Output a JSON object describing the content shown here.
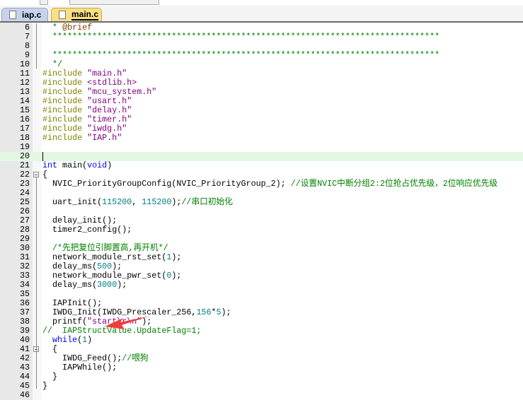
{
  "tabs": [
    {
      "label": "iap.c",
      "active": false
    },
    {
      "label": "main.c",
      "active": true
    }
  ],
  "current_line": 20,
  "lines": [
    {
      "n": "6",
      "seg": [
        [
          "pl",
          "  "
        ],
        [
          "cm",
          "* "
        ],
        [
          "tg",
          "@brief"
        ]
      ]
    },
    {
      "n": "7",
      "seg": [
        [
          "cm",
          "  ******************************************************************************"
        ]
      ]
    },
    {
      "n": "8",
      "seg": []
    },
    {
      "n": "9",
      "seg": [
        [
          "cm",
          "  ******************************************************************************"
        ]
      ]
    },
    {
      "n": "10",
      "seg": [
        [
          "cm",
          "  */"
        ]
      ]
    },
    {
      "n": "11",
      "seg": [
        [
          "pp",
          "#include "
        ],
        [
          "st",
          "\"main.h\""
        ]
      ]
    },
    {
      "n": "12",
      "seg": [
        [
          "pp",
          "#include "
        ],
        [
          "st",
          "<stdlib.h>"
        ]
      ]
    },
    {
      "n": "13",
      "seg": [
        [
          "pp",
          "#include "
        ],
        [
          "st",
          "\"mcu_system.h\""
        ]
      ]
    },
    {
      "n": "14",
      "seg": [
        [
          "pp",
          "#include "
        ],
        [
          "st",
          "\"usart.h\""
        ]
      ]
    },
    {
      "n": "15",
      "seg": [
        [
          "pp",
          "#include "
        ],
        [
          "st",
          "\"delay.h\""
        ]
      ]
    },
    {
      "n": "16",
      "seg": [
        [
          "pp",
          "#include "
        ],
        [
          "st",
          "\"timer.h\""
        ]
      ]
    },
    {
      "n": "17",
      "seg": [
        [
          "pp",
          "#include "
        ],
        [
          "st",
          "\"iwdg.h\""
        ]
      ]
    },
    {
      "n": "18",
      "seg": [
        [
          "pp",
          "#include "
        ],
        [
          "st",
          "\"IAP.h\""
        ]
      ]
    },
    {
      "n": "19",
      "seg": []
    },
    {
      "n": "20",
      "seg": []
    },
    {
      "n": "21",
      "seg": [
        [
          "kw",
          "int"
        ],
        [
          "pl",
          " main("
        ],
        [
          "kw",
          "void"
        ],
        [
          "pl",
          ")"
        ]
      ]
    },
    {
      "n": "22",
      "seg": [
        [
          "pl",
          "{"
        ]
      ]
    },
    {
      "n": "23",
      "seg": [
        [
          "pl",
          "  NVIC_PriorityGroupConfig(NVIC_PriorityGroup_2); "
        ],
        [
          "cm",
          "//设置NVIC中断分组2:2位抢占优先级，2位响应优先级"
        ]
      ]
    },
    {
      "n": "24",
      "seg": []
    },
    {
      "n": "25",
      "seg": [
        [
          "pl",
          "  uart_init("
        ],
        [
          "nu",
          "115200"
        ],
        [
          "pl",
          ", "
        ],
        [
          "nu",
          "115200"
        ],
        [
          "pl",
          ");"
        ],
        [
          "cm",
          "//串口初始化"
        ]
      ]
    },
    {
      "n": "26",
      "seg": []
    },
    {
      "n": "27",
      "seg": [
        [
          "pl",
          "  delay_init();"
        ]
      ]
    },
    {
      "n": "28",
      "seg": [
        [
          "pl",
          "  timer2_config();"
        ]
      ]
    },
    {
      "n": "29",
      "seg": []
    },
    {
      "n": "30",
      "seg": [
        [
          "cm",
          "  /*先把复位引脚置高,再开机*/"
        ]
      ]
    },
    {
      "n": "31",
      "seg": [
        [
          "pl",
          "  network_module_rst_set("
        ],
        [
          "nu",
          "1"
        ],
        [
          "pl",
          ");"
        ]
      ]
    },
    {
      "n": "32",
      "seg": [
        [
          "pl",
          "  delay_ms("
        ],
        [
          "nu",
          "500"
        ],
        [
          "pl",
          ");"
        ]
      ]
    },
    {
      "n": "33",
      "seg": [
        [
          "pl",
          "  network_module_pwr_set("
        ],
        [
          "nu",
          "0"
        ],
        [
          "pl",
          ");"
        ]
      ]
    },
    {
      "n": "34",
      "seg": [
        [
          "pl",
          "  delay_ms("
        ],
        [
          "nu",
          "3000"
        ],
        [
          "pl",
          ");"
        ]
      ]
    },
    {
      "n": "35",
      "seg": []
    },
    {
      "n": "36",
      "seg": [
        [
          "pl",
          "  IAPInit();"
        ]
      ]
    },
    {
      "n": "37",
      "seg": [
        [
          "pl",
          "  IWDG_Init(IWDG_Prescaler_256,"
        ],
        [
          "nu",
          "156"
        ],
        [
          "pl",
          "*"
        ],
        [
          "nu",
          "5"
        ],
        [
          "pl",
          ");"
        ]
      ]
    },
    {
      "n": "38",
      "seg": [
        [
          "pl",
          "  printf("
        ],
        [
          "st",
          "\"start\\r\\n\""
        ],
        [
          "pl",
          ");"
        ]
      ]
    },
    {
      "n": "39",
      "seg": [
        [
          "cm",
          "//  IAPStructValue.UpdateFlag=1;"
        ]
      ]
    },
    {
      "n": "40",
      "seg": [
        [
          "pl",
          "  "
        ],
        [
          "kw",
          "while"
        ],
        [
          "pl",
          "("
        ],
        [
          "nu",
          "1"
        ],
        [
          "pl",
          ")"
        ]
      ]
    },
    {
      "n": "41",
      "seg": [
        [
          "pl",
          "  {"
        ]
      ]
    },
    {
      "n": "42",
      "seg": [
        [
          "pl",
          "    IWDG_Feed();"
        ],
        [
          "cm",
          "//喂狗"
        ]
      ]
    },
    {
      "n": "43",
      "seg": [
        [
          "pl",
          "    IAPWhile();"
        ]
      ]
    },
    {
      "n": "44",
      "seg": [
        [
          "pl",
          "  }"
        ]
      ]
    },
    {
      "n": "45",
      "seg": [
        [
          "pl",
          "}"
        ]
      ]
    },
    {
      "n": "46",
      "seg": []
    }
  ],
  "fold_markers": [
    "22",
    "41"
  ],
  "annotation_color": "#f03c3c"
}
